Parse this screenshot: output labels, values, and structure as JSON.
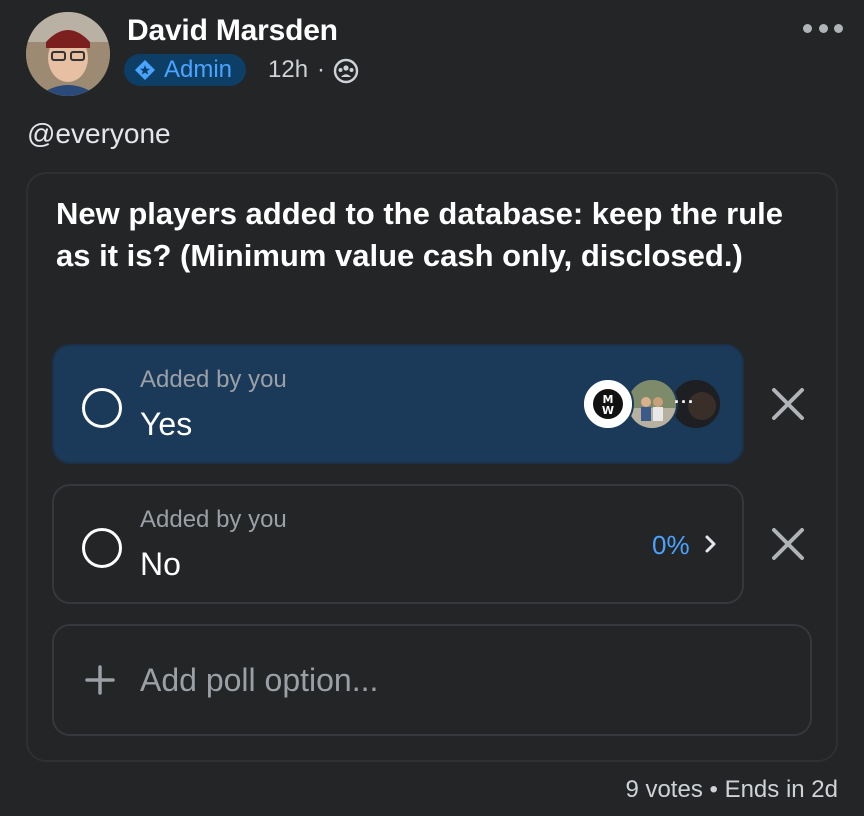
{
  "post": {
    "author": "David Marsden",
    "role_badge": "Admin",
    "time": "12h",
    "separator": "·",
    "text": "@everyone"
  },
  "poll": {
    "question": "New players added to the database: keep the rule as it is? (Minimum value cash only, disclosed.)",
    "options": [
      {
        "sub": "Added by you",
        "label": "Yes",
        "voters_more": "···"
      },
      {
        "sub": "Added by you",
        "label": "No",
        "percent": "0%"
      }
    ],
    "add_option_label": "Add poll option...",
    "votes": "9 votes",
    "bullet": "•",
    "ends": "Ends in 2d"
  },
  "colors": {
    "background": "#232527",
    "selected_option": "#1b3a59",
    "accent": "#4aa3ff",
    "admin_badge_bg": "#0c3e66"
  },
  "icons": {
    "admin": "shield-star-icon",
    "audience": "group-icon",
    "more": "more-dots-icon",
    "remove": "close-icon",
    "add": "plus-icon",
    "chevron": "chevron-right-icon"
  }
}
